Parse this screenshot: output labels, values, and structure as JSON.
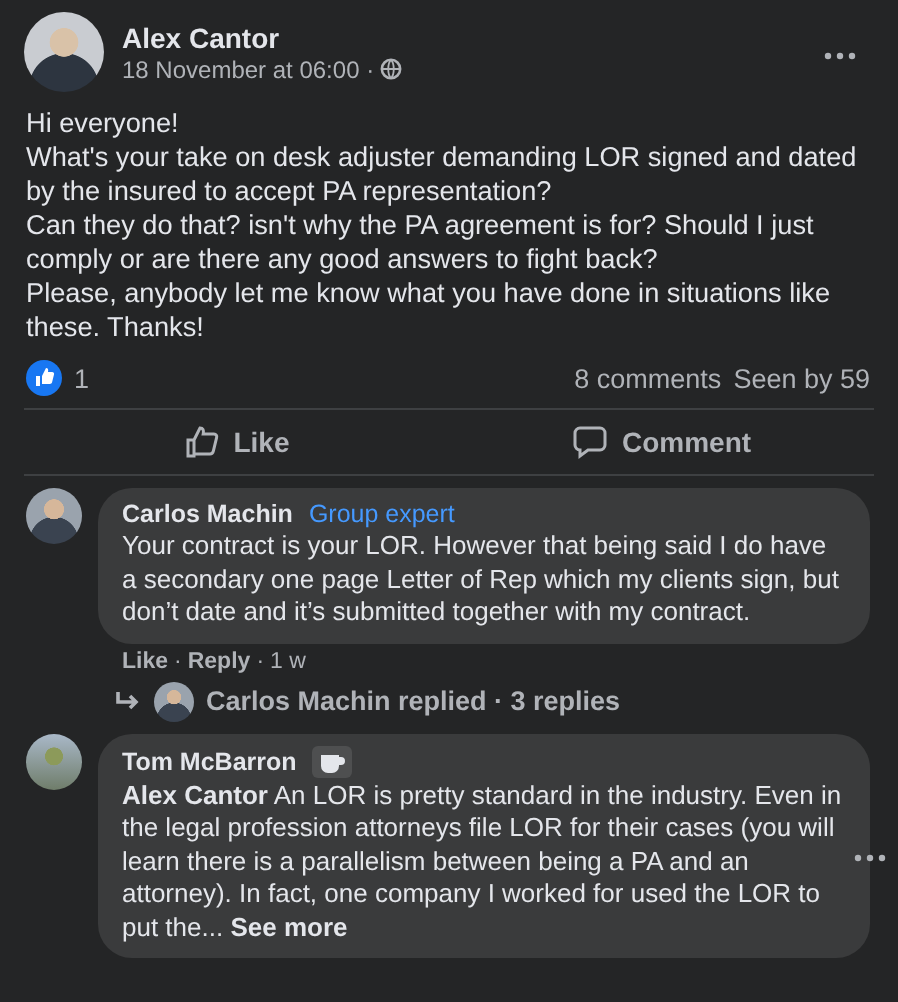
{
  "post": {
    "author": "Alex Cantor",
    "time": "18 November at 06:00 ·",
    "text": [
      "Hi everyone!",
      "What's your take on desk adjuster demanding LOR signed and dated by the insured to accept PA representation?",
      "Can they do that? isn't why the PA agreement is for? Should I just comply or are there any good answers to fight back?",
      "Please, anybody let me know what you have done in situations like these. Thanks!"
    ],
    "reactions": "1",
    "comments_count": "8 comments",
    "seen_by": "Seen by 59"
  },
  "actions": [
    {
      "kind": "like",
      "label": "Like"
    },
    {
      "kind": "comment",
      "label": "Comment"
    }
  ],
  "comments": [
    {
      "author": "Carlos Machin",
      "badge": {
        "kind": "text",
        "label": "Group expert"
      },
      "text": "Your contract is your LOR. However that being said I do have a secondary one page Letter of Rep which my clients sign, but don’t date and it’s submitted together with my contract.",
      "footer": [
        "Like",
        "Reply",
        "1 w"
      ],
      "separator": "·",
      "replies": "Carlos Machin replied · 3 replies"
    },
    {
      "author": "Tom McBarron",
      "badge": {
        "kind": "cup"
      },
      "text": "**Alex Cantor** An LOR is pretty standard in the industry. Even in the legal profession attorneys file LOR for their cases (you will learn there is a parallelism between being a PA and an attorney). In fact, one company I worked for used the LOR to put the...",
      "see_more": "See more"
    }
  ]
}
